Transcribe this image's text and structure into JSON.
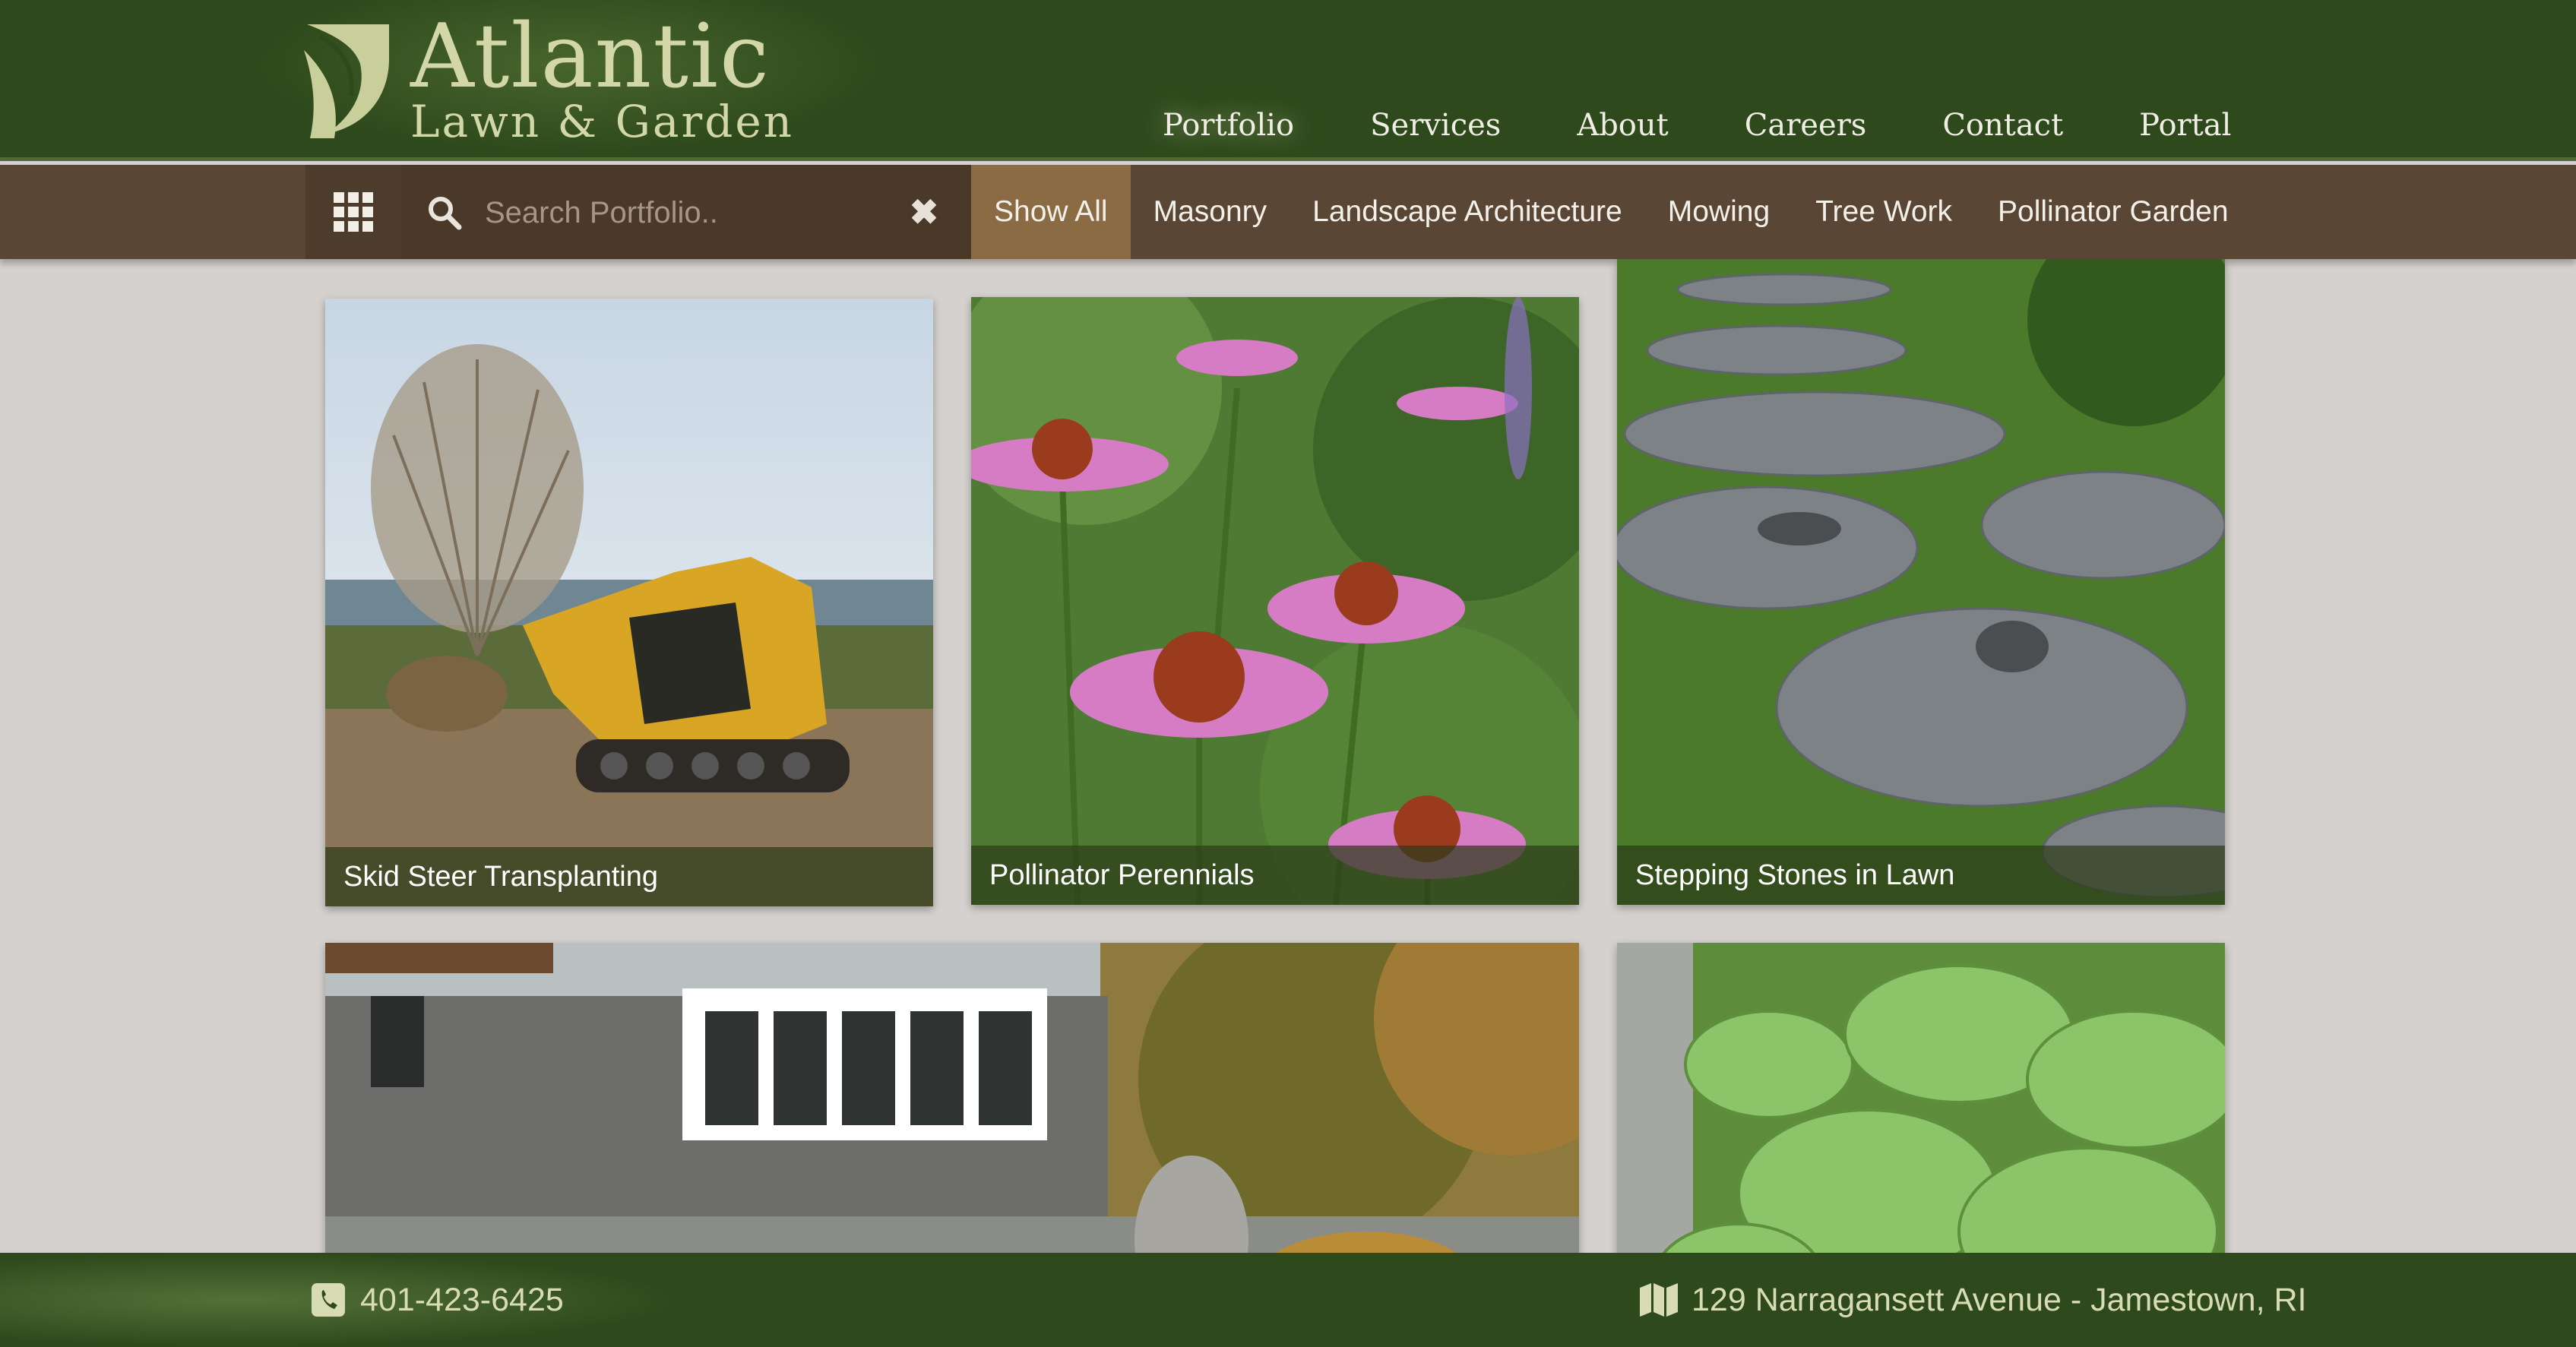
{
  "brand": {
    "title": "Atlantic",
    "subtitle": "Lawn & Garden"
  },
  "nav": {
    "items": [
      {
        "label": "Portfolio",
        "active": true
      },
      {
        "label": "Services",
        "active": false
      },
      {
        "label": "About",
        "active": false
      },
      {
        "label": "Careers",
        "active": false
      },
      {
        "label": "Contact",
        "active": false
      },
      {
        "label": "Portal",
        "active": false
      }
    ]
  },
  "search": {
    "placeholder": "Search Portfolio..",
    "value": ""
  },
  "filters": [
    {
      "label": "Show All",
      "active": true
    },
    {
      "label": "Masonry",
      "active": false
    },
    {
      "label": "Landscape Architecture",
      "active": false
    },
    {
      "label": "Mowing",
      "active": false
    },
    {
      "label": "Tree Work",
      "active": false
    },
    {
      "label": "Pollinator Garden",
      "active": false
    }
  ],
  "gallery": [
    {
      "caption": "Skid Steer Transplanting"
    },
    {
      "caption": "Pollinator Perennials"
    },
    {
      "caption": "Stepping Stones in Lawn"
    },
    {
      "caption": ""
    },
    {
      "caption": ""
    }
  ],
  "footer": {
    "phone": "401-423-6425",
    "address": "129 Narragansett Avenue - Jamestown, RI"
  },
  "colors": {
    "header_bg": "#2e4a1c",
    "filter_bar_bg": "#5a4634",
    "filter_active_bg": "#8a6b43",
    "page_bg": "#d4d1ce",
    "logo_text": "#d3d7a8"
  },
  "icons": {
    "grid": "grid-icon",
    "search": "search-icon",
    "clear": "close-icon",
    "phone": "phone-icon",
    "map": "map-icon"
  }
}
